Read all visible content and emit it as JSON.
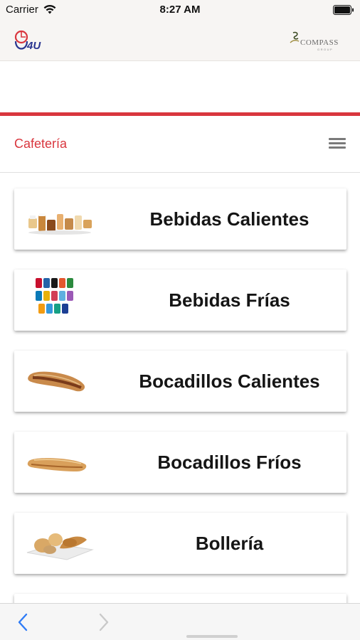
{
  "status_bar": {
    "carrier": "Carrier",
    "time": "8:27 AM",
    "icons": [
      "wifi-icon",
      "battery-icon"
    ]
  },
  "brand": {
    "left_logo": "g4u-logo",
    "left_logo_text": "4U",
    "right_logo": "compass-group-logo",
    "right_logo_text": "COMPASS",
    "right_logo_subtext": "GROUP"
  },
  "section": {
    "title": "Cafetería",
    "menu_icon": "hamburger-menu-icon"
  },
  "categories": [
    {
      "label": "Bebidas Calientes",
      "thumb": "hot-drinks-image"
    },
    {
      "label": "Bebidas Frías",
      "thumb": "cold-drinks-image"
    },
    {
      "label": "Bocadillos Calientes",
      "thumb": "hot-sandwich-image"
    },
    {
      "label": "Bocadillos Fríos",
      "thumb": "cold-sandwich-image"
    },
    {
      "label": "Bollería",
      "thumb": "pastries-image"
    },
    {
      "label": "",
      "thumb": "partial-item-image"
    }
  ],
  "toolbar": {
    "back_icon": "chevron-left-icon",
    "forward_icon": "chevron-right-icon"
  },
  "colors": {
    "accent_red": "#d9363e",
    "header_bg": "#f7f5f3",
    "nav_blue": "#2f7cf6",
    "text_dark": "#151515"
  }
}
